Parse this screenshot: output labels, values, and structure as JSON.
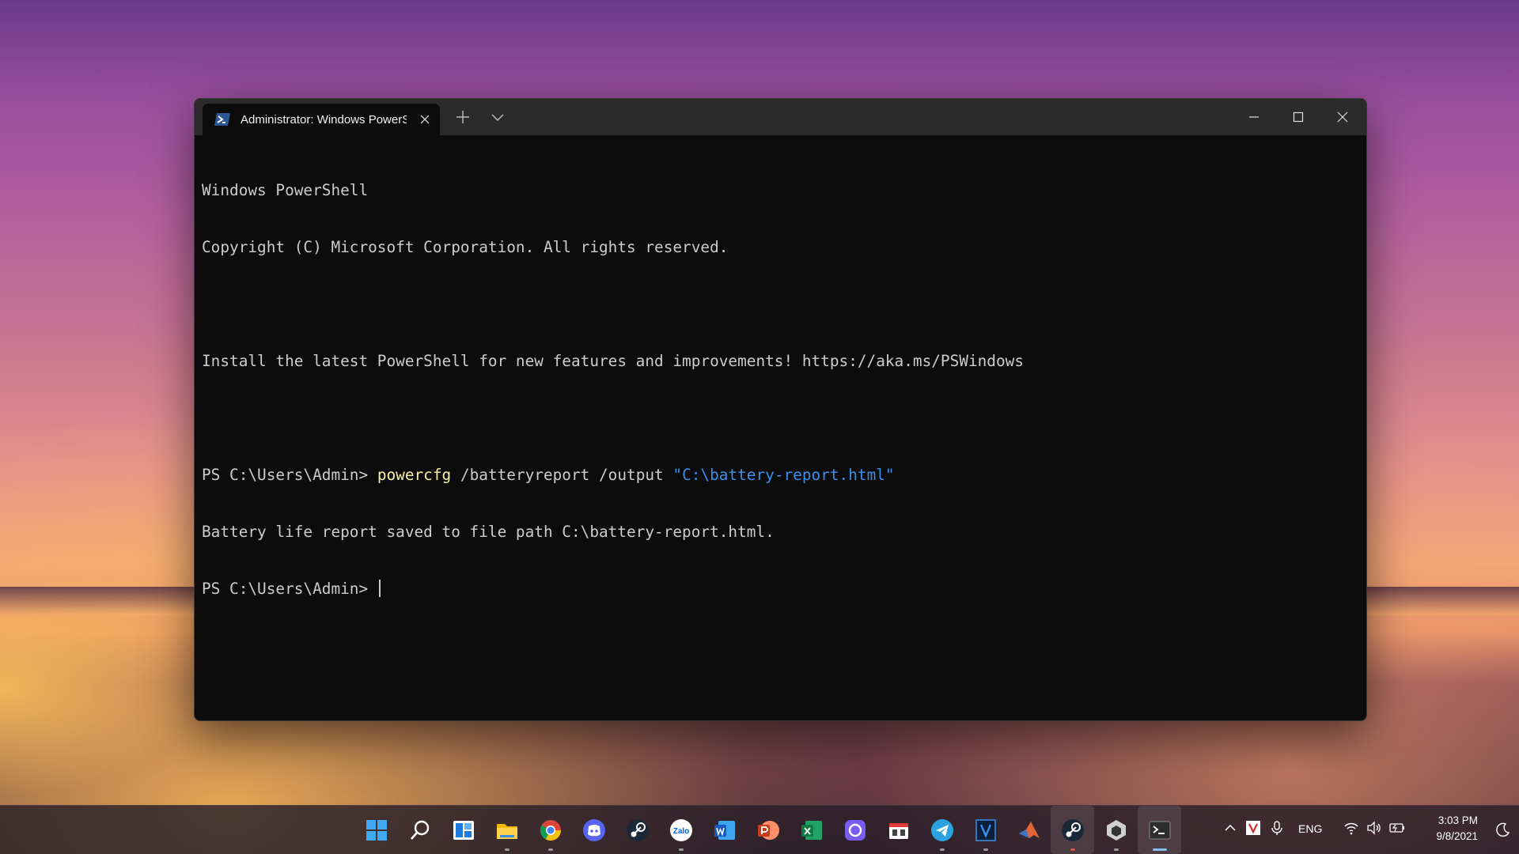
{
  "window": {
    "tab_title": "Administrator: Windows PowerS",
    "accent": "#2b5797"
  },
  "terminal": {
    "line1": "Windows PowerShell",
    "line2": "Copyright (C) Microsoft Corporation. All rights reserved.",
    "line3": "Install the latest PowerShell for new features and improvements! https://aka.ms/PSWindows",
    "prompt1": "PS C:\\Users\\Admin> ",
    "cmd1": "powercfg",
    "args1": " /batteryreport /output ",
    "str1": "\"C:\\battery-report.html\"",
    "output1": "Battery life report saved to file path C:\\battery-report.html.",
    "prompt2": "PS C:\\Users\\Admin> "
  },
  "taskbar": {
    "icons": [
      "start-icon",
      "search-icon",
      "widgets-icon",
      "file-explorer-icon",
      "chrome-icon",
      "discord-icon",
      "steam-icon",
      "zalo-icon",
      "word-icon",
      "powerpoint-icon",
      "excel-icon",
      "cortana-icon",
      "app-icon",
      "telegram-icon",
      "vscode-icon",
      "matlab-icon",
      "steam-icon",
      "unity-icon",
      "terminal-icon"
    ],
    "zalo_label": "Zalo"
  },
  "tray": {
    "language": "ENG",
    "time": "3:03 PM",
    "date": "9/8/2021"
  }
}
